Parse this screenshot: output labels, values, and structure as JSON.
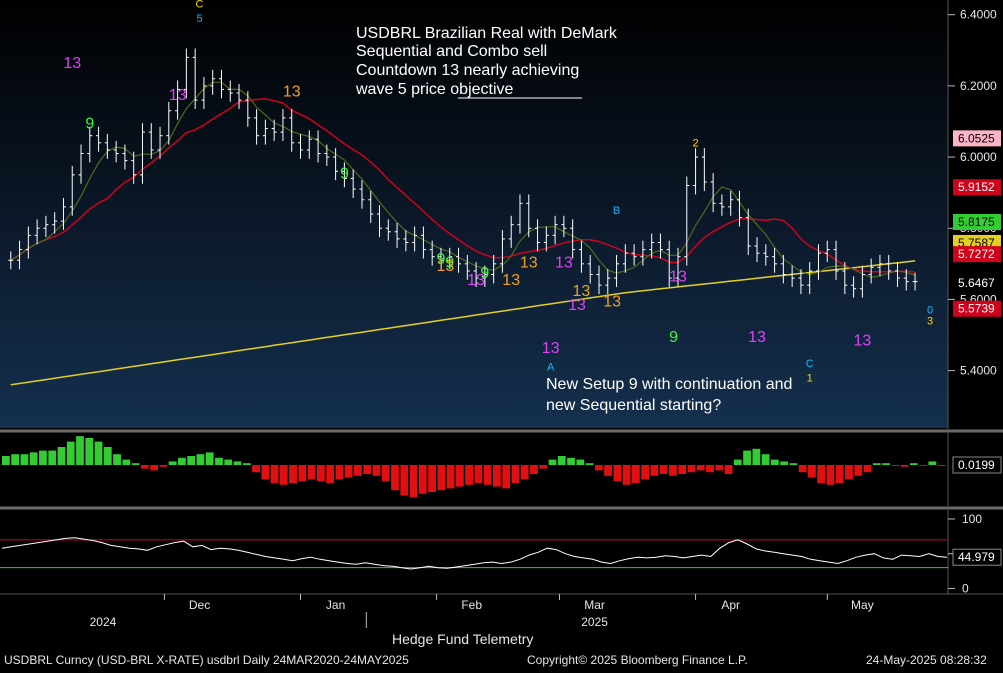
{
  "window": {
    "footer_security": "USDBRL Curncy (USD-BRL X-RATE) usdbrl  Daily 24MAR2020-24MAY2025",
    "footer_copyright": "Copyright© 2025 Bloomberg Finance L.P.",
    "footer_timestamp": "24-May-2025 08:28:32",
    "watermark": "Hedge Fund Telemetry"
  },
  "chart_data": {
    "type": "candlestick",
    "annotation_title": [
      "USDBRL Brazilian Real with DeMark",
      "Sequential and Combo sell",
      "Countdown 13 nearly achieving",
      "wave 5 price objective"
    ],
    "annotation_bottom": [
      "New Setup 9 with continuation and",
      "new Sequential starting?"
    ],
    "x_axis": {
      "months": [
        {
          "label": "Dec",
          "day": 45
        },
        {
          "label": "Jan",
          "day": 76
        },
        {
          "label": "Feb",
          "day": 107
        },
        {
          "label": "Mar",
          "day": 135
        },
        {
          "label": "Apr",
          "day": 166
        },
        {
          "label": "May",
          "day": 196
        }
      ],
      "years": [
        {
          "label": "2024",
          "day": 23
        },
        {
          "label": "2025",
          "day": 135
        }
      ],
      "domain_days": [
        0,
        213
      ]
    },
    "price_panel": {
      "ylim": [
        5.25,
        6.43
      ],
      "ticks": [
        {
          "value": 6.4,
          "label": "6.4000"
        },
        {
          "value": 6.2,
          "label": "6.2000"
        },
        {
          "value": 6.0,
          "label": "6.0000"
        },
        {
          "value": 5.8,
          "label": "5.8000"
        },
        {
          "value": 5.6,
          "label": "5.6000"
        },
        {
          "value": 5.4,
          "label": "5.4000"
        }
      ],
      "candles_close": [
        [
          2,
          5.71
        ],
        [
          4,
          5.74
        ],
        [
          6,
          5.78
        ],
        [
          8,
          5.8
        ],
        [
          10,
          5.81
        ],
        [
          12,
          5.82
        ],
        [
          14,
          5.86
        ],
        [
          16,
          5.95
        ],
        [
          18,
          6.01
        ],
        [
          20,
          6.06
        ],
        [
          22,
          6.04
        ],
        [
          24,
          6.02
        ],
        [
          26,
          6.01
        ],
        [
          28,
          5.99
        ],
        [
          30,
          5.95
        ],
        [
          32,
          6.07
        ],
        [
          34,
          6.02
        ],
        [
          36,
          6.06
        ],
        [
          38,
          6.13
        ],
        [
          40,
          6.19
        ],
        [
          42,
          6.28
        ],
        [
          44,
          6.16
        ],
        [
          46,
          6.2
        ],
        [
          48,
          6.22
        ],
        [
          50,
          6.19
        ],
        [
          52,
          6.18
        ],
        [
          54,
          6.16
        ],
        [
          56,
          6.11
        ],
        [
          58,
          6.06
        ],
        [
          60,
          6.08
        ],
        [
          62,
          6.07
        ],
        [
          64,
          6.11
        ],
        [
          66,
          6.04
        ],
        [
          68,
          6.02
        ],
        [
          70,
          6.05
        ],
        [
          72,
          6.01
        ],
        [
          74,
          6.0
        ],
        [
          76,
          5.96
        ],
        [
          78,
          5.94
        ],
        [
          80,
          5.91
        ],
        [
          82,
          5.88
        ],
        [
          84,
          5.84
        ],
        [
          86,
          5.8
        ],
        [
          88,
          5.79
        ],
        [
          90,
          5.77
        ],
        [
          92,
          5.76
        ],
        [
          94,
          5.78
        ],
        [
          96,
          5.74
        ],
        [
          98,
          5.72
        ],
        [
          100,
          5.71
        ],
        [
          102,
          5.72
        ],
        [
          104,
          5.7
        ],
        [
          106,
          5.68
        ],
        [
          108,
          5.66
        ],
        [
          110,
          5.67
        ],
        [
          112,
          5.7
        ],
        [
          114,
          5.77
        ],
        [
          116,
          5.81
        ],
        [
          118,
          5.87
        ],
        [
          120,
          5.8
        ],
        [
          122,
          5.76
        ],
        [
          124,
          5.78
        ],
        [
          126,
          5.81
        ],
        [
          128,
          5.8
        ],
        [
          130,
          5.74
        ],
        [
          132,
          5.7
        ],
        [
          134,
          5.67
        ],
        [
          136,
          5.64
        ],
        [
          138,
          5.66
        ],
        [
          140,
          5.7
        ],
        [
          142,
          5.73
        ],
        [
          144,
          5.72
        ],
        [
          146,
          5.74
        ],
        [
          148,
          5.76
        ],
        [
          150,
          5.74
        ],
        [
          152,
          5.66
        ],
        [
          154,
          5.72
        ],
        [
          156,
          5.92
        ],
        [
          158,
          6.0
        ],
        [
          160,
          5.93
        ],
        [
          162,
          5.87
        ],
        [
          164,
          5.86
        ],
        [
          166,
          5.88
        ],
        [
          168,
          5.83
        ],
        [
          170,
          5.75
        ],
        [
          172,
          5.73
        ],
        [
          174,
          5.72
        ],
        [
          176,
          5.7
        ],
        [
          178,
          5.67
        ],
        [
          180,
          5.66
        ],
        [
          182,
          5.64
        ],
        [
          184,
          5.68
        ],
        [
          186,
          5.73
        ],
        [
          188,
          5.74
        ],
        [
          190,
          5.68
        ],
        [
          192,
          5.64
        ],
        [
          194,
          5.63
        ],
        [
          196,
          5.67
        ],
        [
          198,
          5.69
        ],
        [
          200,
          5.7
        ],
        [
          202,
          5.68
        ],
        [
          204,
          5.66
        ],
        [
          206,
          5.65
        ],
        [
          208,
          5.65
        ]
      ],
      "right_labels": [
        {
          "text": "6.0525",
          "value": 6.0525,
          "bg": "#ffb3c6",
          "fg": "#000000"
        },
        {
          "text": "5.9152",
          "value": 5.9152,
          "bg": "#d0021b",
          "fg": "#ffffff"
        },
        {
          "text": "5.8175",
          "value": 5.8175,
          "bg": "#33cc33",
          "fg": "#000000"
        },
        {
          "text": "5.7587",
          "value": 5.7587,
          "bg": "#e5cf23",
          "fg": "#000000"
        },
        {
          "text": "5.7272",
          "value": 5.7272,
          "bg": "#d0021b",
          "fg": "#ffffff"
        },
        {
          "text": "5.6467",
          "value": 5.6467,
          "bg": "#000000",
          "fg": "#ffffff"
        },
        {
          "text": "5.5739",
          "value": 5.5739,
          "bg": "#d0021b",
          "fg": "#ffffff"
        }
      ],
      "demark_labels": [
        {
          "t": "C",
          "d": 45,
          "v": 6.42,
          "c": "#ffd700",
          "s": 11
        },
        {
          "t": "5",
          "d": 45,
          "v": 6.38,
          "c": "#00bfff",
          "s": 11
        },
        {
          "t": "13",
          "d": 16,
          "v": 6.25,
          "c": "#e040fb",
          "s": 16
        },
        {
          "t": "13",
          "d": 40,
          "v": 6.16,
          "c": "#e040fb",
          "s": 16
        },
        {
          "t": "13",
          "d": 66,
          "v": 6.17,
          "c": "#f0a020",
          "s": 16
        },
        {
          "t": "13",
          "d": 128,
          "v": 5.69,
          "c": "#e040fb",
          "s": 16
        },
        {
          "t": "13",
          "d": 116,
          "v": 5.64,
          "c": "#f0a020",
          "s": 16
        },
        {
          "t": "13",
          "d": 132,
          "v": 5.61,
          "c": "#f0a020",
          "s": 16
        },
        {
          "t": "13",
          "d": 139,
          "v": 5.58,
          "c": "#f0a020",
          "s": 16
        },
        {
          "t": "13",
          "d": 131,
          "v": 5.57,
          "c": "#e040fb",
          "s": 16
        },
        {
          "t": "13",
          "d": 154,
          "v": 5.65,
          "c": "#e040fb",
          "s": 16
        },
        {
          "t": "13",
          "d": 172,
          "v": 5.48,
          "c": "#e040fb",
          "s": 16
        },
        {
          "t": "13",
          "d": 125,
          "v": 5.45,
          "c": "#e040fb",
          "s": 16
        },
        {
          "t": "13",
          "d": 196,
          "v": 5.47,
          "c": "#e040fb",
          "s": 16
        },
        {
          "t": "13",
          "d": 108,
          "v": 5.64,
          "c": "#e040fb",
          "s": 16
        },
        {
          "t": "9",
          "d": 20,
          "v": 6.08,
          "c": "#33ff33",
          "s": 16
        },
        {
          "t": "9",
          "d": 78,
          "v": 5.94,
          "c": "#33ff33",
          "s": 16
        },
        {
          "t": "9",
          "d": 100,
          "v": 5.7,
          "c": "#33ff33",
          "s": 16
        },
        {
          "t": "9",
          "d": 102,
          "v": 5.69,
          "c": "#33ff33",
          "s": 16
        },
        {
          "t": "9",
          "d": 110,
          "v": 5.66,
          "c": "#33ff33",
          "s": 16
        },
        {
          "t": "13",
          "d": 120,
          "v": 5.69,
          "c": "#f0a020",
          "s": 16
        },
        {
          "t": "13",
          "d": 101,
          "v": 5.68,
          "c": "#f0a020",
          "s": 16
        },
        {
          "t": "9",
          "d": 153,
          "v": 5.48,
          "c": "#33ff33",
          "s": 16
        },
        {
          "t": "2",
          "d": 158,
          "v": 6.03,
          "c": "#ffd700",
          "s": 11
        },
        {
          "t": "A",
          "d": 125,
          "v": 5.4,
          "c": "#00bfff",
          "s": 11
        },
        {
          "t": "C",
          "d": 184,
          "v": 5.41,
          "c": "#00bfff",
          "s": 11
        },
        {
          "t": "1",
          "d": 184,
          "v": 5.37,
          "c": "#ffd700",
          "s": 11
        },
        {
          "t": "B",
          "d": 140,
          "v": 5.84,
          "c": "#00bfff",
          "s": 11
        },
        {
          "t": "0",
          "d": 234,
          "v": 5.56,
          "c": "#00bfff",
          "s": 11
        },
        {
          "t": "3",
          "d": 234,
          "v": 5.53,
          "c": "#ffd700",
          "s": 11
        }
      ]
    },
    "histogram_panel": {
      "value_label": "0.0199",
      "values": [
        0.5,
        0.6,
        0.6,
        0.7,
        0.8,
        0.8,
        1.0,
        1.3,
        1.6,
        1.5,
        1.3,
        1.0,
        0.6,
        0.3,
        0.1,
        -0.2,
        -0.3,
        -0.1,
        0.2,
        0.4,
        0.5,
        0.6,
        0.7,
        0.4,
        0.3,
        0.2,
        0.1,
        -0.4,
        -0.8,
        -1.0,
        -1.1,
        -1.0,
        -0.9,
        -0.8,
        -0.9,
        -1.0,
        -0.8,
        -0.7,
        -0.6,
        -0.5,
        -0.6,
        -0.9,
        -1.4,
        -1.7,
        -1.8,
        -1.6,
        -1.5,
        -1.4,
        -1.3,
        -1.2,
        -1.1,
        -1.0,
        -1.1,
        -1.2,
        -1.3,
        -1.0,
        -0.8,
        -0.5,
        -0.2,
        0.3,
        0.5,
        0.4,
        0.3,
        0.1,
        -0.3,
        -0.6,
        -0.9,
        -1.1,
        -1.0,
        -0.8,
        -0.6,
        -0.5,
        -0.6,
        -0.5,
        -0.4,
        -0.3,
        -0.4,
        -0.3,
        -0.5,
        0.3,
        0.8,
        0.9,
        0.6,
        0.3,
        0.2,
        0.1,
        -0.4,
        -0.7,
        -1.0,
        -1.1,
        -1.0,
        -0.8,
        -0.6,
        -0.4,
        0.1,
        0.1,
        0.0,
        -0.1,
        0.1,
        0.0,
        0.2,
        0.0
      ]
    },
    "rsi_panel": {
      "ylim": [
        -5,
        110
      ],
      "ticks": [
        {
          "value": 100,
          "label": "100"
        },
        {
          "value": 50,
          "label": "50"
        },
        {
          "value": 0,
          "label": "0"
        }
      ],
      "upper_band": 70,
      "lower_band": 30,
      "value_label": "44.979",
      "values": [
        58,
        60,
        62,
        64,
        66,
        68,
        70,
        72,
        73,
        71,
        69,
        66,
        62,
        60,
        58,
        57,
        55,
        60,
        63,
        66,
        68,
        60,
        62,
        56,
        58,
        57,
        55,
        52,
        49,
        46,
        44,
        42,
        40,
        43,
        45,
        42,
        40,
        38,
        36,
        35,
        37,
        35,
        33,
        32,
        30,
        28,
        30,
        32,
        30,
        29,
        31,
        33,
        35,
        37,
        38,
        36,
        38,
        42,
        48,
        52,
        58,
        56,
        50,
        46,
        44,
        42,
        38,
        36,
        40,
        43,
        45,
        44,
        45,
        47,
        46,
        44,
        46,
        48,
        46,
        58,
        66,
        70,
        64,
        57,
        54,
        52,
        50,
        48,
        46,
        42,
        40,
        38,
        36,
        40,
        45,
        48,
        50,
        44,
        42,
        48,
        47,
        46,
        50,
        46,
        45
      ]
    }
  }
}
